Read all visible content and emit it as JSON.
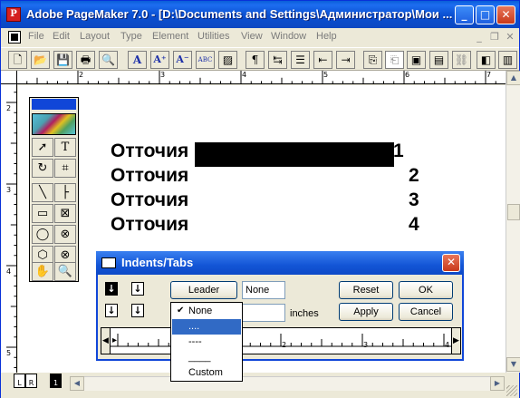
{
  "window": {
    "title": "Adobe PageMaker 7.0 - [D:\\Documents and Settings\\Администратор\\Мои ...",
    "minimize": "_",
    "maximize": "□",
    "close": "✕"
  },
  "menu": {
    "items": [
      "File",
      "Edit",
      "Layout",
      "Type",
      "Element",
      "Utilities",
      "View",
      "Window",
      "Help"
    ]
  },
  "toolbar": {
    "letters": [
      "A",
      "A⁺",
      "A⁻"
    ],
    "spell": "ABC"
  },
  "ruler": {
    "h_numbers": [
      "1",
      "2",
      "3",
      "4",
      "5",
      "6",
      "7",
      "8"
    ],
    "v_numbers": [
      "2",
      "3",
      "4",
      "5"
    ]
  },
  "document": {
    "lines": [
      {
        "text": "Отточия",
        "num": "1"
      },
      {
        "text": "Отточия",
        "num": "2"
      },
      {
        "text": "Отточия",
        "num": "3"
      },
      {
        "text": "Отточия",
        "num": "4"
      }
    ]
  },
  "toolbox": {
    "text_tool": "T"
  },
  "dialog": {
    "title": "Indents/Tabs",
    "leader_button": "Leader",
    "leader_value": "None",
    "position_value": "",
    "units_label": "inches",
    "reset_button": "Reset",
    "ok_button": "OK",
    "apply_button": "Apply",
    "cancel_button": "Cancel",
    "ruler_numbers": [
      "1",
      "2",
      "3",
      "4"
    ]
  },
  "leader_dropdown": {
    "options": [
      {
        "label": "None",
        "checked": true,
        "selected": false
      },
      {
        "label": "....",
        "checked": false,
        "selected": true
      },
      {
        "label": "----",
        "checked": false,
        "selected": false
      },
      {
        "label": "____",
        "checked": false,
        "selected": false
      },
      {
        "label": "Custom",
        "checked": false,
        "selected": false
      }
    ]
  },
  "pages": {
    "left": "L",
    "right": "R",
    "current": "1"
  },
  "colors": {
    "titlebar": "#0a5fd8",
    "selection": "#316ac5",
    "dialog_border": "#1046d8"
  }
}
